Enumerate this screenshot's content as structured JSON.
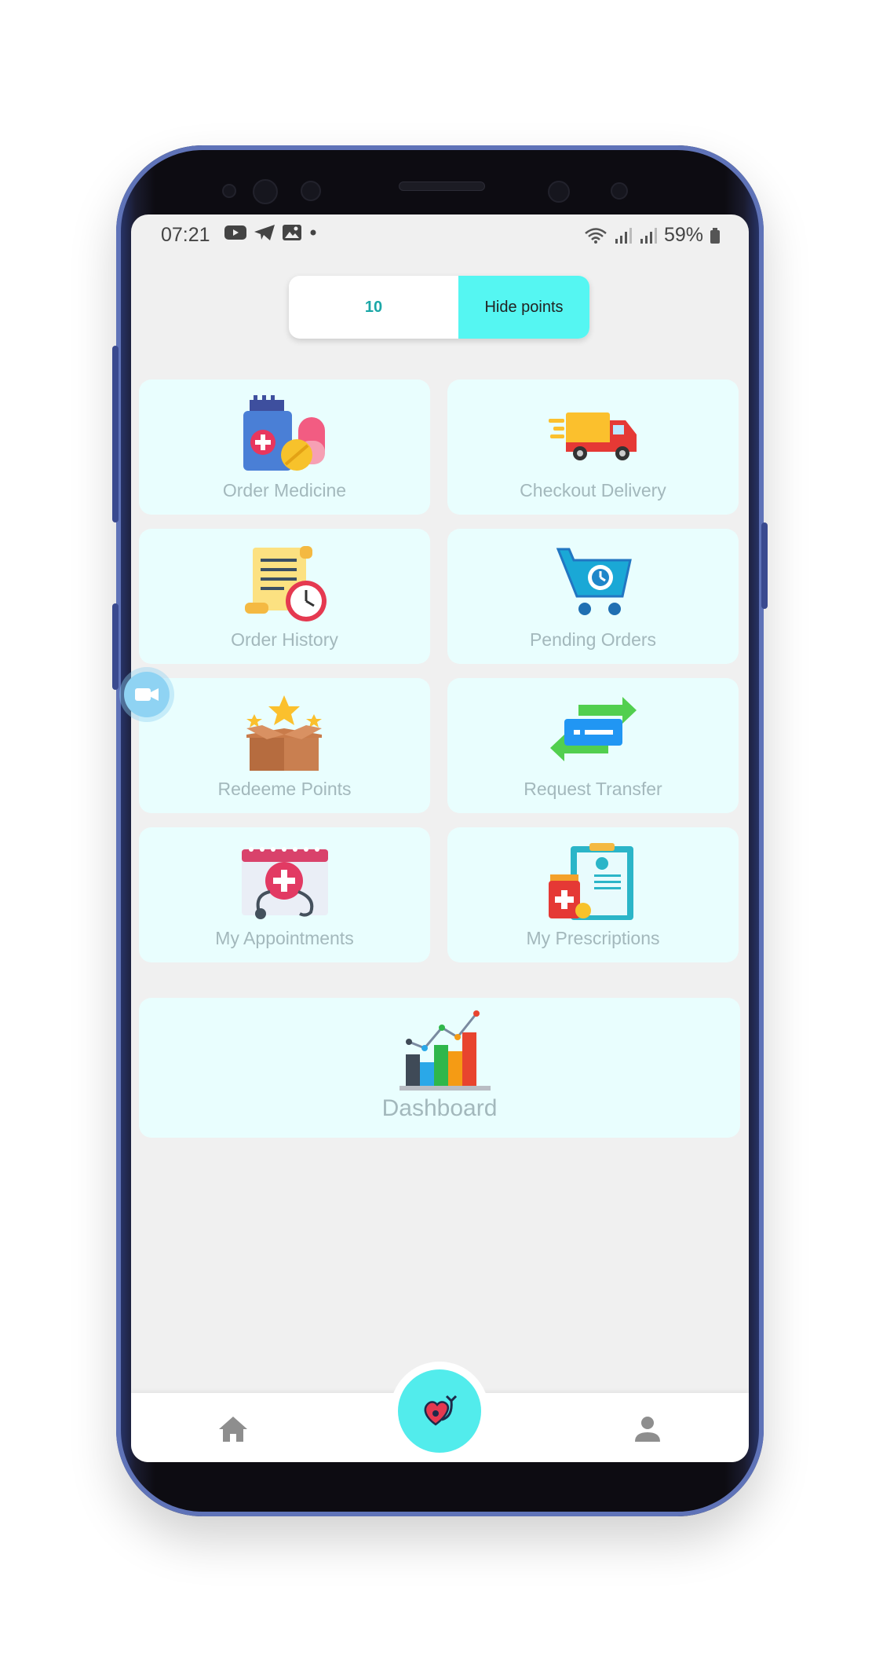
{
  "status_bar": {
    "time": "07:21",
    "battery": "59%"
  },
  "points": {
    "value": "10",
    "toggle_label": "Hide points"
  },
  "menu": {
    "items": [
      {
        "label": "Order Medicine",
        "icon": "medicine-bottle-icon"
      },
      {
        "label": "Checkout Delivery",
        "icon": "delivery-truck-icon"
      },
      {
        "label": "Order History",
        "icon": "order-history-icon"
      },
      {
        "label": "Pending Orders",
        "icon": "shopping-cart-clock-icon"
      },
      {
        "label": "Redeeme Points",
        "icon": "reward-box-icon"
      },
      {
        "label": "Request Transfer",
        "icon": "transfer-arrows-icon"
      },
      {
        "label": "My Appointments",
        "icon": "calendar-medical-icon"
      },
      {
        "label": "My Prescriptions",
        "icon": "prescription-clipboard-icon"
      }
    ],
    "dashboard_label": "Dashboard"
  },
  "bottom_nav": {
    "home_icon": "home-icon",
    "center_icon": "heart-stethoscope-icon",
    "profile_icon": "profile-icon"
  },
  "colors": {
    "accent": "#55f6f2",
    "tile_bg": "#e9fefe",
    "label": "#a3b8bc",
    "points_text": "#1ba7a7"
  }
}
